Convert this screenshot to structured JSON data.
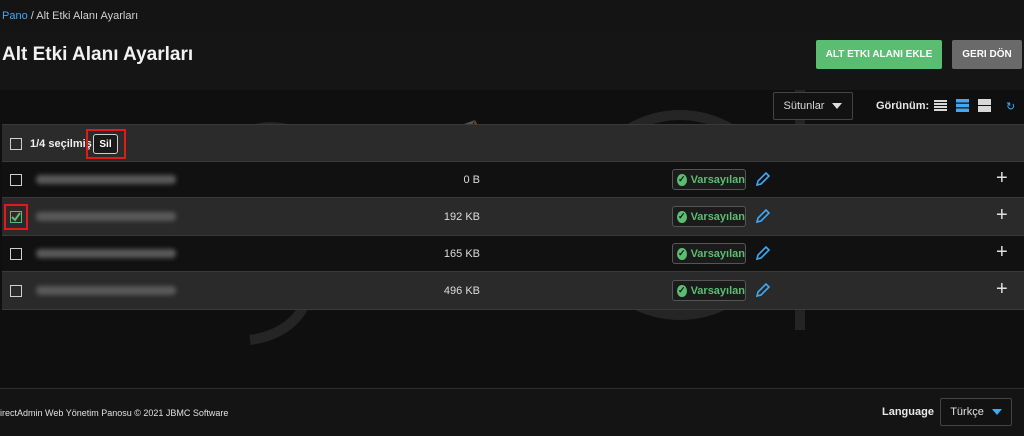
{
  "breadcrumb": {
    "home": "Pano",
    "separator": " / ",
    "current": "Alt Etki Alanı Ayarları"
  },
  "page": {
    "title": "Alt Etki Alanı Ayarları"
  },
  "actions": {
    "add_label": "ALT ETKI ALANI EKLE",
    "back_label": "GERI DÖN"
  },
  "toolbar": {
    "columns_label": "Sütunlar",
    "view_label": "Görünüm:",
    "view_icons": [
      "list-compact-icon",
      "list-comfortable-icon",
      "list-spacious-icon"
    ],
    "refresh_icon": "refresh-icon"
  },
  "table": {
    "selection_text": "1/4 seçilmiş",
    "delete_label": "Sil",
    "rows": [
      {
        "size": "0 B",
        "status": "Varsayılan",
        "checked": false
      },
      {
        "size": "192 KB",
        "status": "Varsayılan",
        "checked": true
      },
      {
        "size": "165 KB",
        "status": "Varsayılan",
        "checked": false
      },
      {
        "size": "496 KB",
        "status": "Varsayılan",
        "checked": false
      }
    ]
  },
  "footer": {
    "copyright": "irectAdmin Web Yönetim Panosu © 2021 JBMC Software",
    "language_label": "Language",
    "language_value": "Türkçe"
  },
  "colors": {
    "accent": "#3fa9f5",
    "success": "#5bbd72",
    "highlight": "#e01b1b"
  }
}
